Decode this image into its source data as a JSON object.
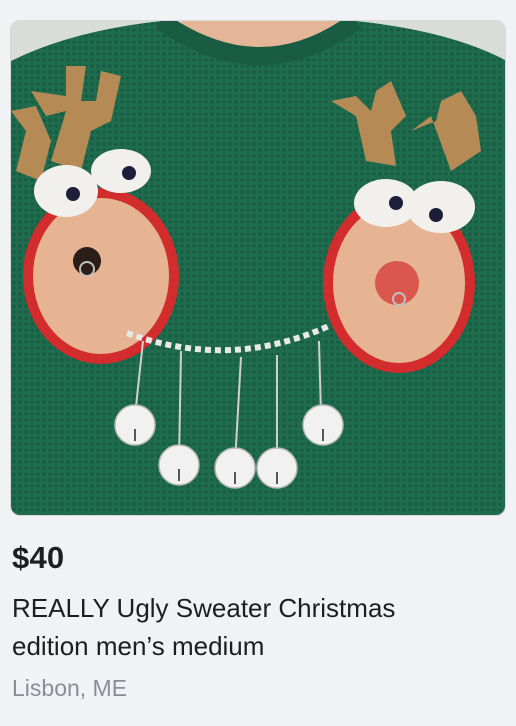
{
  "listing": {
    "price": "$40",
    "title_line_1": "REALLY Ugly Sweater Christmas",
    "title_line_2": "edition men’s medium",
    "location": "Lisbon, ME"
  },
  "photo": {
    "alt": "listing-photo",
    "sweater_color": "#1f6b4e",
    "trim_color": "#d22c2c",
    "antler_color": "#b58a55"
  }
}
